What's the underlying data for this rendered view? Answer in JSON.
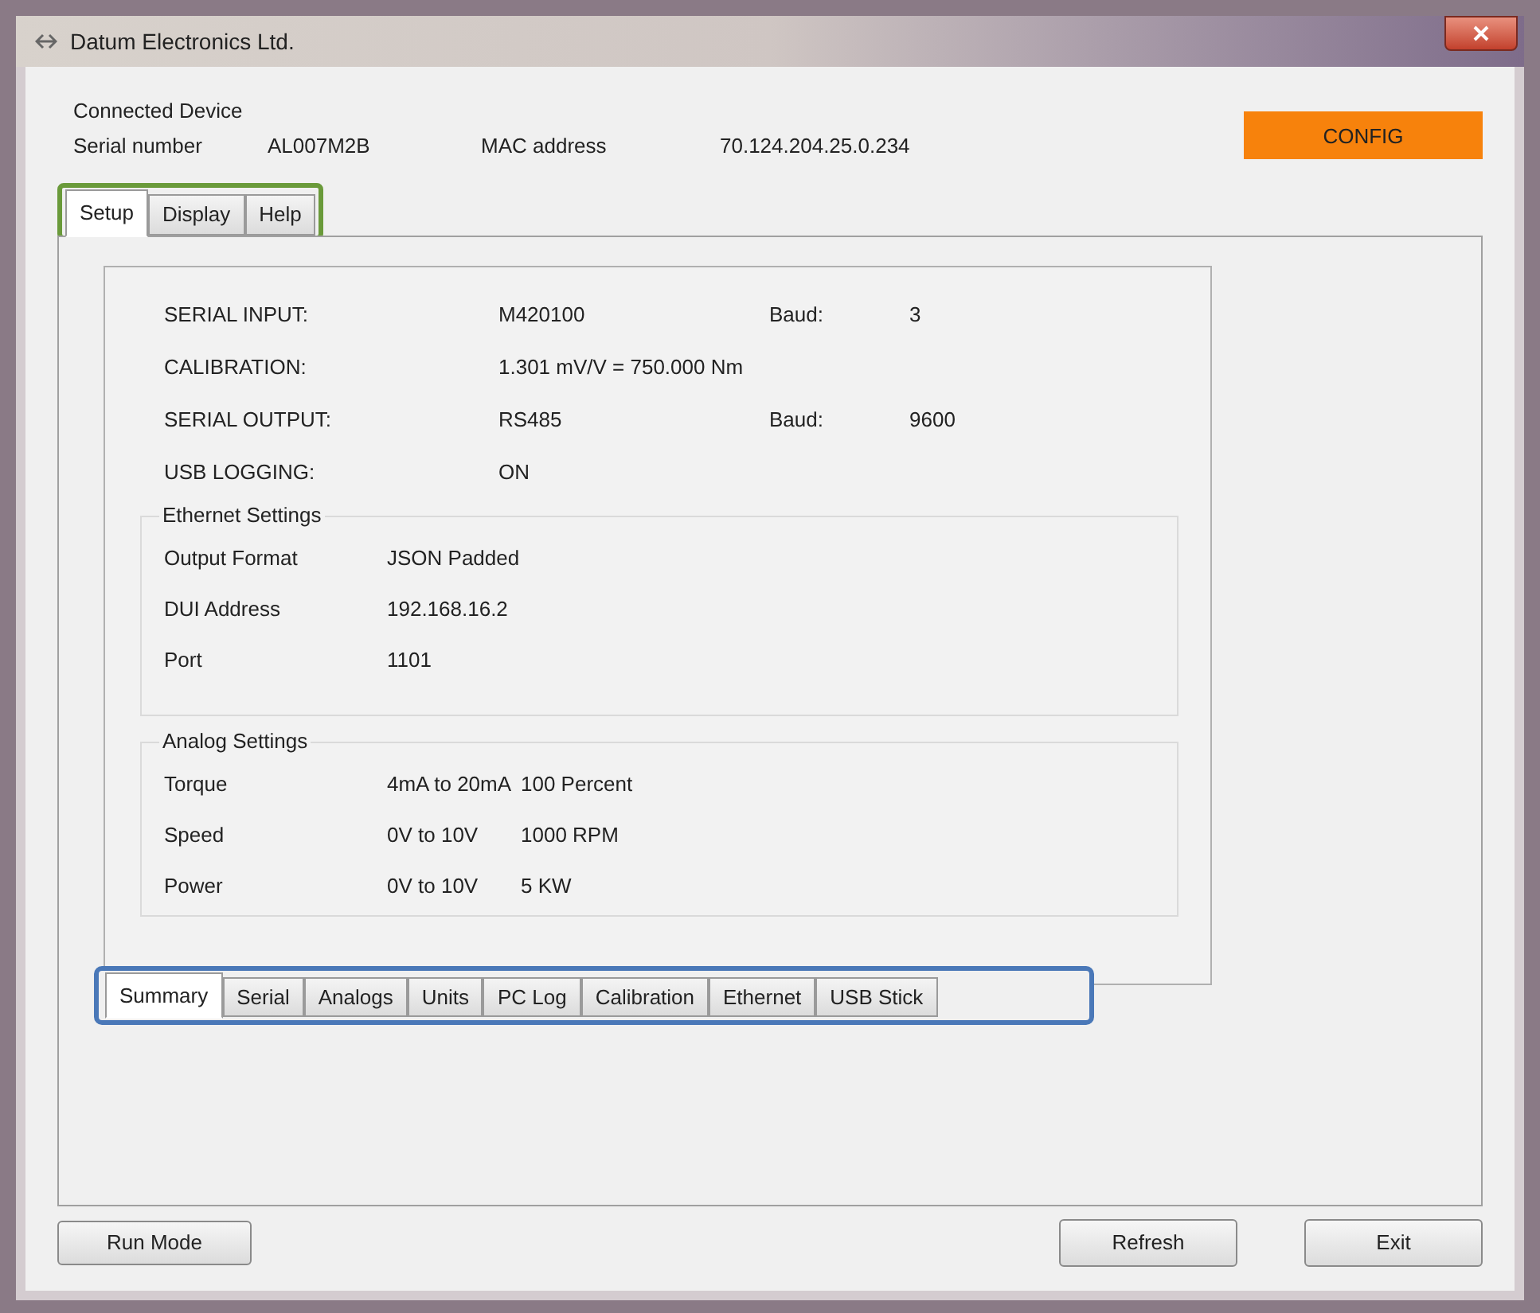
{
  "window": {
    "title": "Datum Electronics Ltd."
  },
  "device": {
    "heading": "Connected Device",
    "serial_label": "Serial number",
    "serial_value": "AL007M2B",
    "mac_label": "MAC address",
    "mac_value": "70.124.204.25.0.234",
    "mode_badge": "CONFIG"
  },
  "top_tabs": [
    {
      "label": "Setup",
      "selected": true
    },
    {
      "label": "Display",
      "selected": false
    },
    {
      "label": "Help",
      "selected": false
    }
  ],
  "summary_rows": [
    {
      "label": "SERIAL INPUT:",
      "value": "M420100",
      "extra_label": "Baud:",
      "extra_value": "3"
    },
    {
      "label": "CALIBRATION:",
      "value": "1.301 mV/V = 750.000 Nm"
    },
    {
      "label": "SERIAL OUTPUT:",
      "value": "RS485",
      "extra_label": "Baud:",
      "extra_value": "9600"
    },
    {
      "label": "USB LOGGING:",
      "value": "ON"
    }
  ],
  "ethernet": {
    "title": "Ethernet Settings",
    "rows": [
      {
        "label": "Output Format",
        "value": "JSON Padded"
      },
      {
        "label": "DUI Address",
        "value": "192.168.16.2"
      },
      {
        "label": "Port",
        "value": "1101"
      }
    ]
  },
  "analog": {
    "title": "Analog Settings",
    "rows": [
      {
        "label": "Torque",
        "range": "4mA to 20mA",
        "scale": "100 Percent"
      },
      {
        "label": "Speed",
        "range": "0V to 10V",
        "scale": "1000 RPM"
      },
      {
        "label": "Power",
        "range": "0V to 10V",
        "scale": "5 KW"
      }
    ]
  },
  "bottom_tabs": [
    {
      "label": "Summary",
      "selected": true
    },
    {
      "label": "Serial",
      "selected": false
    },
    {
      "label": "Analogs",
      "selected": false
    },
    {
      "label": "Units",
      "selected": false
    },
    {
      "label": "PC Log",
      "selected": false
    },
    {
      "label": "Calibration",
      "selected": false
    },
    {
      "label": "Ethernet",
      "selected": false
    },
    {
      "label": "USB Stick",
      "selected": false
    }
  ],
  "buttons": {
    "left": [
      "Run Mode"
    ],
    "right": [
      "Refresh",
      "Exit"
    ]
  }
}
